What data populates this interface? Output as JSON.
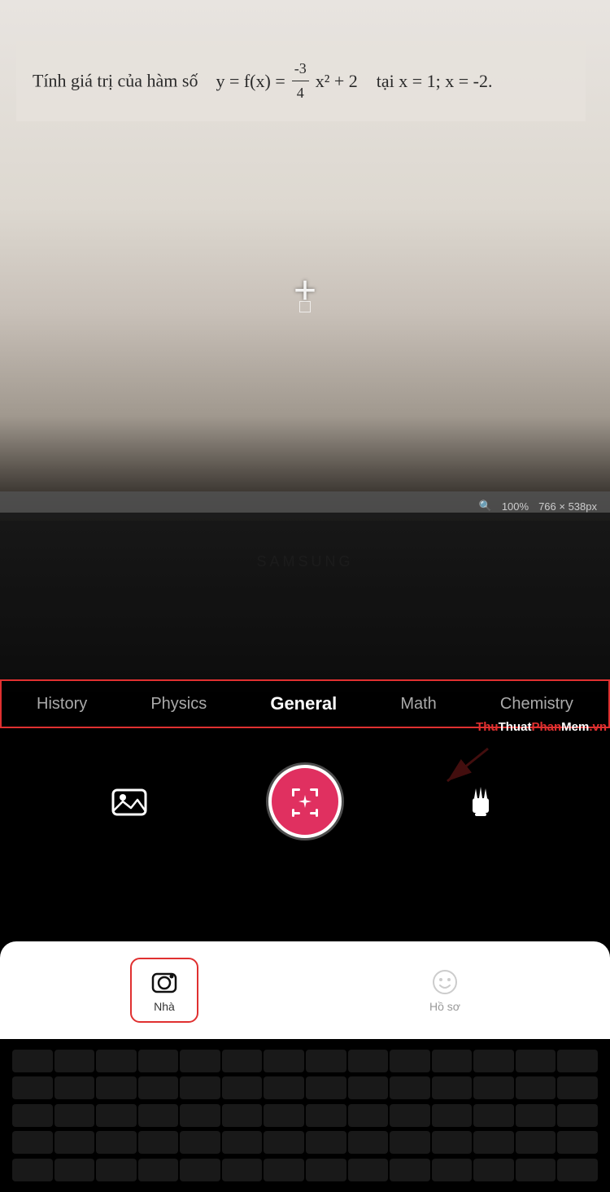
{
  "camera": {
    "math_problem": "Tính giá trị của hàm số",
    "formula": "y = f(x) = ",
    "numerator": "-3",
    "denominator": "4",
    "formula_end": "x² + 2",
    "condition": "tại x = 1; x = -2.",
    "zoom_level": "100%",
    "dimensions": "766 × 538px"
  },
  "samsung_brand": "SAMSUNG",
  "categories": [
    {
      "id": "history",
      "label": "History",
      "active": false
    },
    {
      "id": "physics",
      "label": "Physics",
      "active": false
    },
    {
      "id": "general",
      "label": "General",
      "active": true
    },
    {
      "id": "math",
      "label": "Math",
      "active": false
    },
    {
      "id": "chemistry",
      "label": "Chemistry",
      "active": false
    }
  ],
  "watermark": {
    "part1": "Thu",
    "part2": "Thuat",
    "part3": "Phan",
    "part4": "Mem",
    "part5": ".vn"
  },
  "nav": {
    "home_label": "Nhà",
    "profile_label": "Hồ sơ"
  },
  "icons": {
    "gallery": "🏔",
    "capture_icon": "⊕",
    "torch": "🕯",
    "home_icon": "📷",
    "profile_icon": "😊"
  }
}
